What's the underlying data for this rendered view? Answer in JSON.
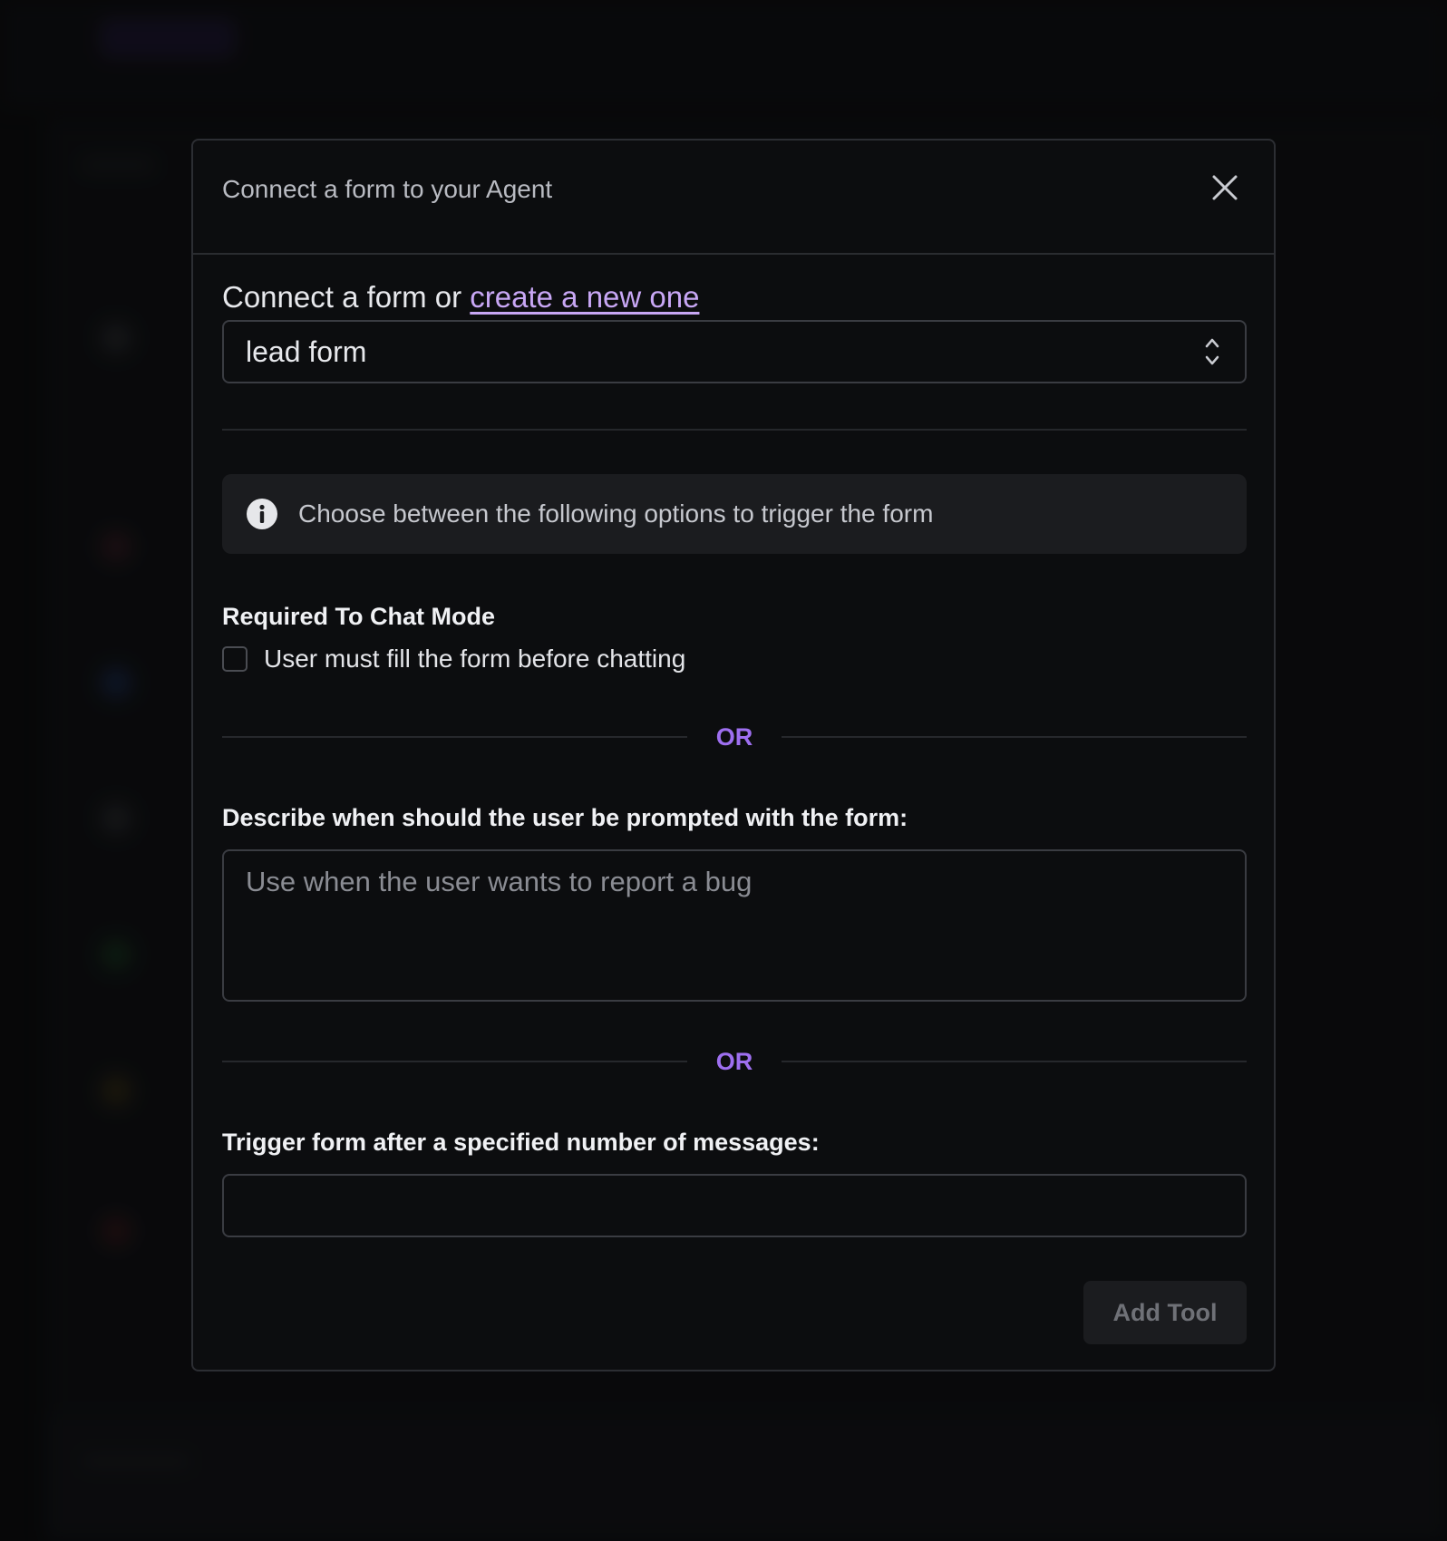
{
  "modal": {
    "title": "Connect a form to your Agent",
    "connect_prefix": "Connect a form or ",
    "create_link": "create a new one",
    "selected_form": "lead form",
    "info_text": "Choose between the following options to trigger the form",
    "required_label": "Required To Chat Mode",
    "checkbox_label": "User must fill the form before chatting",
    "checkbox_checked": false,
    "or_text_1": "OR",
    "describe_label": "Describe when should the user be prompted with the form:",
    "describe_placeholder": "Use when the user wants to report a bug",
    "or_text_2": "OR",
    "trigger_label": "Trigger form after a specified number of messages:",
    "trigger_value": "",
    "add_tool_label": "Add Tool"
  },
  "colors": {
    "accent": "#9e6ff0",
    "link": "#c8a7f5",
    "background": "#0c0d0f"
  },
  "icons": {
    "close": "close-icon",
    "select": "chevron-up-down-icon",
    "info": "info-icon"
  }
}
